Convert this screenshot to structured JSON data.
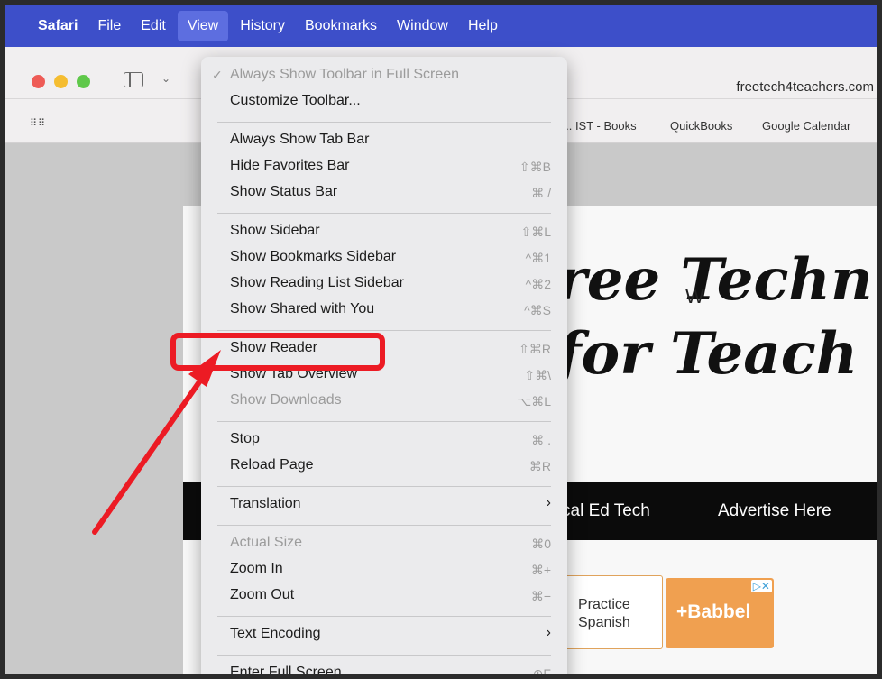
{
  "menubar": {
    "apple": "",
    "items": [
      "Safari",
      "File",
      "Edit",
      "View",
      "History",
      "Bookmarks",
      "Window",
      "Help"
    ],
    "active_item": "View"
  },
  "toolbar": {
    "url": "freetech4teachers.com"
  },
  "favorites": {
    "items": [
      "s... IST - Books",
      "QuickBooks",
      "Google Calendar"
    ]
  },
  "page": {
    "title_line1": "ree Techn",
    "title_line2": "for Teach",
    "title_trailing": "W",
    "nav": [
      "cal Ed Tech",
      "Advertise Here"
    ],
    "ad_practice": "Practice Spanish",
    "ad_babbel": "+Babbel",
    "ad_choice": "▷✕"
  },
  "view_menu": {
    "groups": [
      [
        {
          "label": "Always Show Toolbar in Full Screen",
          "shortcut": "",
          "disabled": true,
          "checked": true
        },
        {
          "label": "Customize Toolbar...",
          "shortcut": ""
        }
      ],
      [
        {
          "label": "Always Show Tab Bar",
          "shortcut": ""
        },
        {
          "label": "Hide Favorites Bar",
          "shortcut": "⇧⌘B"
        },
        {
          "label": "Show Status Bar",
          "shortcut": "⌘ /"
        }
      ],
      [
        {
          "label": "Show Sidebar",
          "shortcut": "⇧⌘L"
        },
        {
          "label": "Show Bookmarks Sidebar",
          "shortcut": "^⌘1"
        },
        {
          "label": "Show Reading List Sidebar",
          "shortcut": "^⌘2"
        },
        {
          "label": "Show Shared with You",
          "shortcut": "^⌘S"
        }
      ],
      [
        {
          "label": "Show Reader",
          "shortcut": "⇧⌘R"
        },
        {
          "label": "Show Tab Overview",
          "shortcut": "⇧⌘\\"
        },
        {
          "label": "Show Downloads",
          "shortcut": "⌥⌘L",
          "disabled": true
        }
      ],
      [
        {
          "label": "Stop",
          "shortcut": "⌘ ."
        },
        {
          "label": "Reload Page",
          "shortcut": "⌘R"
        }
      ],
      [
        {
          "label": "Translation",
          "shortcut": "›"
        }
      ],
      [
        {
          "label": "Actual Size",
          "shortcut": "⌘0",
          "disabled": true
        },
        {
          "label": "Zoom In",
          "shortcut": "⌘+"
        },
        {
          "label": "Zoom Out",
          "shortcut": "⌘−"
        }
      ],
      [
        {
          "label": "Text Encoding",
          "shortcut": "›"
        }
      ],
      [
        {
          "label": "Enter Full Screen",
          "shortcut": "⊕F"
        }
      ]
    ]
  },
  "colors": {
    "menubar": "#3d4fc9",
    "highlight": "#ec1b24",
    "ad_orange": "#f0a050"
  }
}
